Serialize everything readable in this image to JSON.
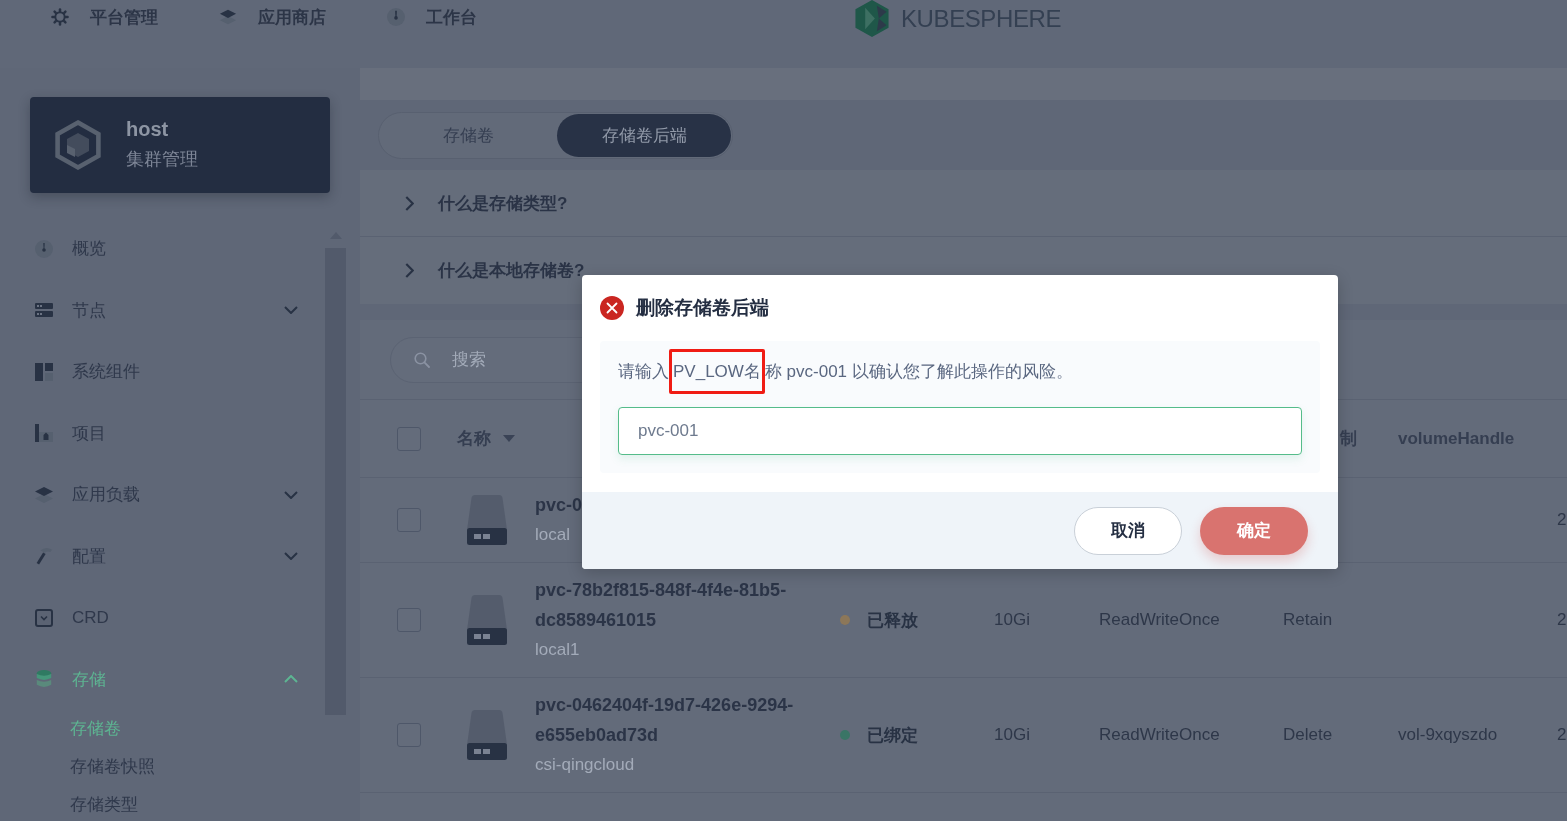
{
  "top_nav": {
    "items": [
      {
        "label": "平台管理"
      },
      {
        "label": "应用商店"
      },
      {
        "label": "工作台"
      }
    ],
    "logo_text": "KUBESPHERE"
  },
  "sidebar": {
    "cluster": {
      "name": "host",
      "subtitle": "集群管理"
    },
    "items": [
      {
        "label": "概览",
        "kind": "link",
        "selected": false
      },
      {
        "label": "节点",
        "kind": "group",
        "expanded": false,
        "selected": false
      },
      {
        "label": "系统组件",
        "kind": "link",
        "selected": false
      },
      {
        "label": "项目",
        "kind": "link",
        "selected": false
      },
      {
        "label": "应用负载",
        "kind": "group",
        "expanded": false,
        "selected": false
      },
      {
        "label": "配置",
        "kind": "group",
        "expanded": false,
        "selected": false
      },
      {
        "label": "CRD",
        "kind": "link",
        "selected": false
      },
      {
        "label": "存储",
        "kind": "group",
        "expanded": true,
        "selected": true,
        "children": [
          {
            "label": "存储卷",
            "selected": true
          },
          {
            "label": "存储卷快照",
            "selected": false
          },
          {
            "label": "存储类型",
            "selected": false
          }
        ]
      }
    ]
  },
  "tabs": [
    {
      "label": "存储卷",
      "selected": false
    },
    {
      "label": "存储卷后端",
      "selected": true
    }
  ],
  "faq": [
    {
      "question": "什么是存储类型?",
      "expanded": false
    },
    {
      "question": "什么是本地存储卷?",
      "expanded": false
    }
  ],
  "search": {
    "placeholder": "搜索"
  },
  "table": {
    "all_selected": false,
    "header": {
      "name": "名称",
      "column_6": "制",
      "volume_handle": "volumeHandle"
    },
    "rows": [
      {
        "selected": false,
        "name": "pvc-0",
        "subtitle": "local",
        "column_8": "2"
      },
      {
        "selected": false,
        "name": "pvc-78b2f815-848f-4f4e-81b5-dc8589461015",
        "subtitle": "local1",
        "status": {
          "label": "已释放",
          "color": "#8c7759"
        },
        "capacity": "10Gi",
        "access_mode": "ReadWriteOnce",
        "column_6": "Retain",
        "column_8": "2"
      },
      {
        "selected": false,
        "name": "pvc-0462404f-19d7-426e-9294-e655eb0ad73d",
        "subtitle": "csi-qingcloud",
        "status": {
          "label": "已绑定",
          "color": "#3a7566"
        },
        "capacity": "10Gi",
        "access_mode": "ReadWriteOnce",
        "column_6": "Delete",
        "volume_handle": "vol-9xqyszdo",
        "column_8": "2"
      }
    ]
  },
  "dialog": {
    "title": "删除存储卷后端",
    "prompt": "请输入PV_LOW名称 pvc-001 以确认您了解此操作的风险。",
    "input": {
      "placeholder": "pvc-001"
    },
    "annotations": [
      {
        "kind": "highlight-frame"
      }
    ],
    "buttons": [
      {
        "label": "取消",
        "kind": "secondary"
      },
      {
        "label": "确定",
        "kind": "danger"
      }
    ]
  }
}
